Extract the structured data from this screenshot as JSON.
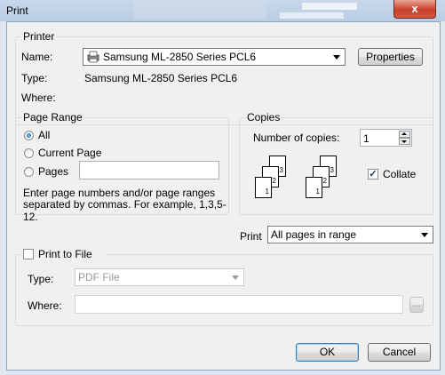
{
  "window": {
    "title": "Print",
    "close_glyph": "x"
  },
  "printer": {
    "group_label": "Printer",
    "name_label": "Name:",
    "name_value": "Samsung ML-2850 Series PCL6",
    "properties_label": "Properties",
    "type_label": "Type:",
    "type_value": "Samsung ML-2850 Series PCL6",
    "where_label": "Where:"
  },
  "page_range": {
    "group_label": "Page Range",
    "options": [
      "All",
      "Current Page",
      "Pages"
    ],
    "selected": "All",
    "pages_value": "",
    "hint_line1": "Enter page numbers and/or page ranges",
    "hint_line2": "separated by commas.  For example, 1,3,5-12."
  },
  "copies": {
    "group_label": "Copies",
    "number_label": "Number of copies:",
    "number_value": "1",
    "collate_label": "Collate",
    "collate_checked": true,
    "page_numbers": [
      "3",
      "2",
      "1"
    ]
  },
  "print_what": {
    "label": "Print",
    "value": "All pages in range"
  },
  "print_to_file": {
    "label": "Print to File",
    "checked": false,
    "type_label": "Type:",
    "type_value": "PDF File",
    "where_label": "Where:",
    "where_value": "",
    "browse_label": "..."
  },
  "buttons": {
    "ok": "OK",
    "cancel": "Cancel"
  },
  "colors": {
    "titlebar": "#bfd1e6",
    "close_button": "#c7402a",
    "dialog_bg": "#f0f0f0"
  }
}
